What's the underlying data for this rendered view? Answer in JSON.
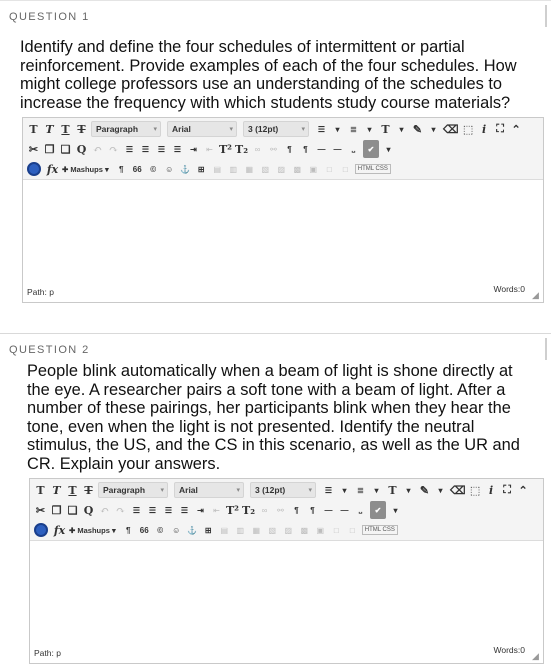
{
  "questions": [
    {
      "label": "QUESTION 1",
      "prompt": "Identify and define the four schedules of intermittent or partial\nreinforcement. Provide examples of each of the four schedules. How\nmight college professors use an understanding of the schedules to\nincrease the frequency with which students study course materials?",
      "editor": {
        "paragraph": "Paragraph",
        "font": "Arial",
        "size": "3 (12pt)",
        "mashups": "Mashups",
        "path": "Path: p",
        "words": "Words:0"
      }
    },
    {
      "label": "QUESTION 2",
      "prompt": "People blink automatically when a beam of light is shone directly at\nthe eye. A researcher pairs a soft tone with a beam of light. After a\nnumber of these pairings, her participants blink when they hear the\ntone, even when the light is not presented. Identify the neutral\nstimulus, the US, and the CS in this scenario, as well as the UR and\nCR. Explain your answers.",
      "editor": {
        "paragraph": "Paragraph",
        "font": "Arial",
        "size": "3 (12pt)",
        "mashups": "Mashups",
        "path": "Path: p",
        "words": "Words:0"
      }
    }
  ],
  "icons": {
    "bold": "T",
    "italic": "T",
    "underline": "T",
    "strike": "T",
    "fx": "fx",
    "paragraph_mark": "¶",
    "quote": "66",
    "copyright": "©",
    "emoji": "☺",
    "anchor": "⚓",
    "table": "⊞",
    "html_label": "HTML CSS",
    "check": "✔",
    "italic_i": "i",
    "expand": "⛶",
    "collapse": "⌃",
    "cut": "✂",
    "undo": "↶",
    "redo": "↷",
    "list_bullet": "☰",
    "list_num": "≣",
    "text_color": "T",
    "highlight": "✎",
    "eraser": "⌫",
    "spell": "⬚",
    "sup": "T²",
    "sub": "T₂",
    "link": "🔗",
    "unlink": "⛓",
    "ltr": "¶",
    "rtl": "¶",
    "hr": "—",
    "nbsp": "⎵",
    "find": "Q",
    "copy": "❐",
    "paste": "❑",
    "grip": "◢"
  }
}
